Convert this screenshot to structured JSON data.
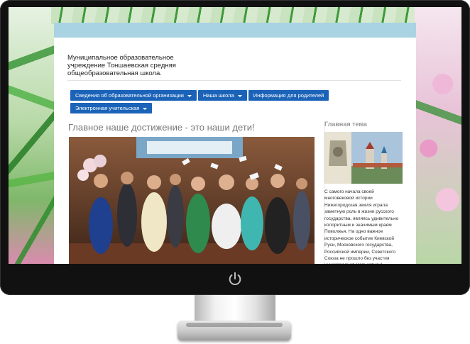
{
  "site": {
    "title": "Муниципальное образовательное\nучреждение Тоншаевская средняя\nобщеобразовательная школа."
  },
  "nav": {
    "items": [
      {
        "label": "Сведения об образовательной организации",
        "has_dropdown": true
      },
      {
        "label": "Наша школа",
        "has_dropdown": true
      },
      {
        "label": "Информация для родителей",
        "has_dropdown": false
      },
      {
        "label": "Электронная учительская",
        "has_dropdown": true
      }
    ]
  },
  "main": {
    "headline": "Главное наше достижение - это наши дети!"
  },
  "sidebar": {
    "title": "Главная тема",
    "text": "С самого начала своей многовековой истории Нижегородская земля играла заметную роль в жизни русского государства, являясь удивительно колоритным и значимым краем Поволжья. На одно важное историческое событие Киевской Руси, Московского государства, Российской империи, Советского Союза не прошло без участия нижегородцев (горьковчан). Нижегородский край являлся"
  },
  "colors": {
    "nav_bg": "#1b63b8",
    "top_bar": "#a9d3e3"
  },
  "icons": {
    "power": "power-icon"
  }
}
